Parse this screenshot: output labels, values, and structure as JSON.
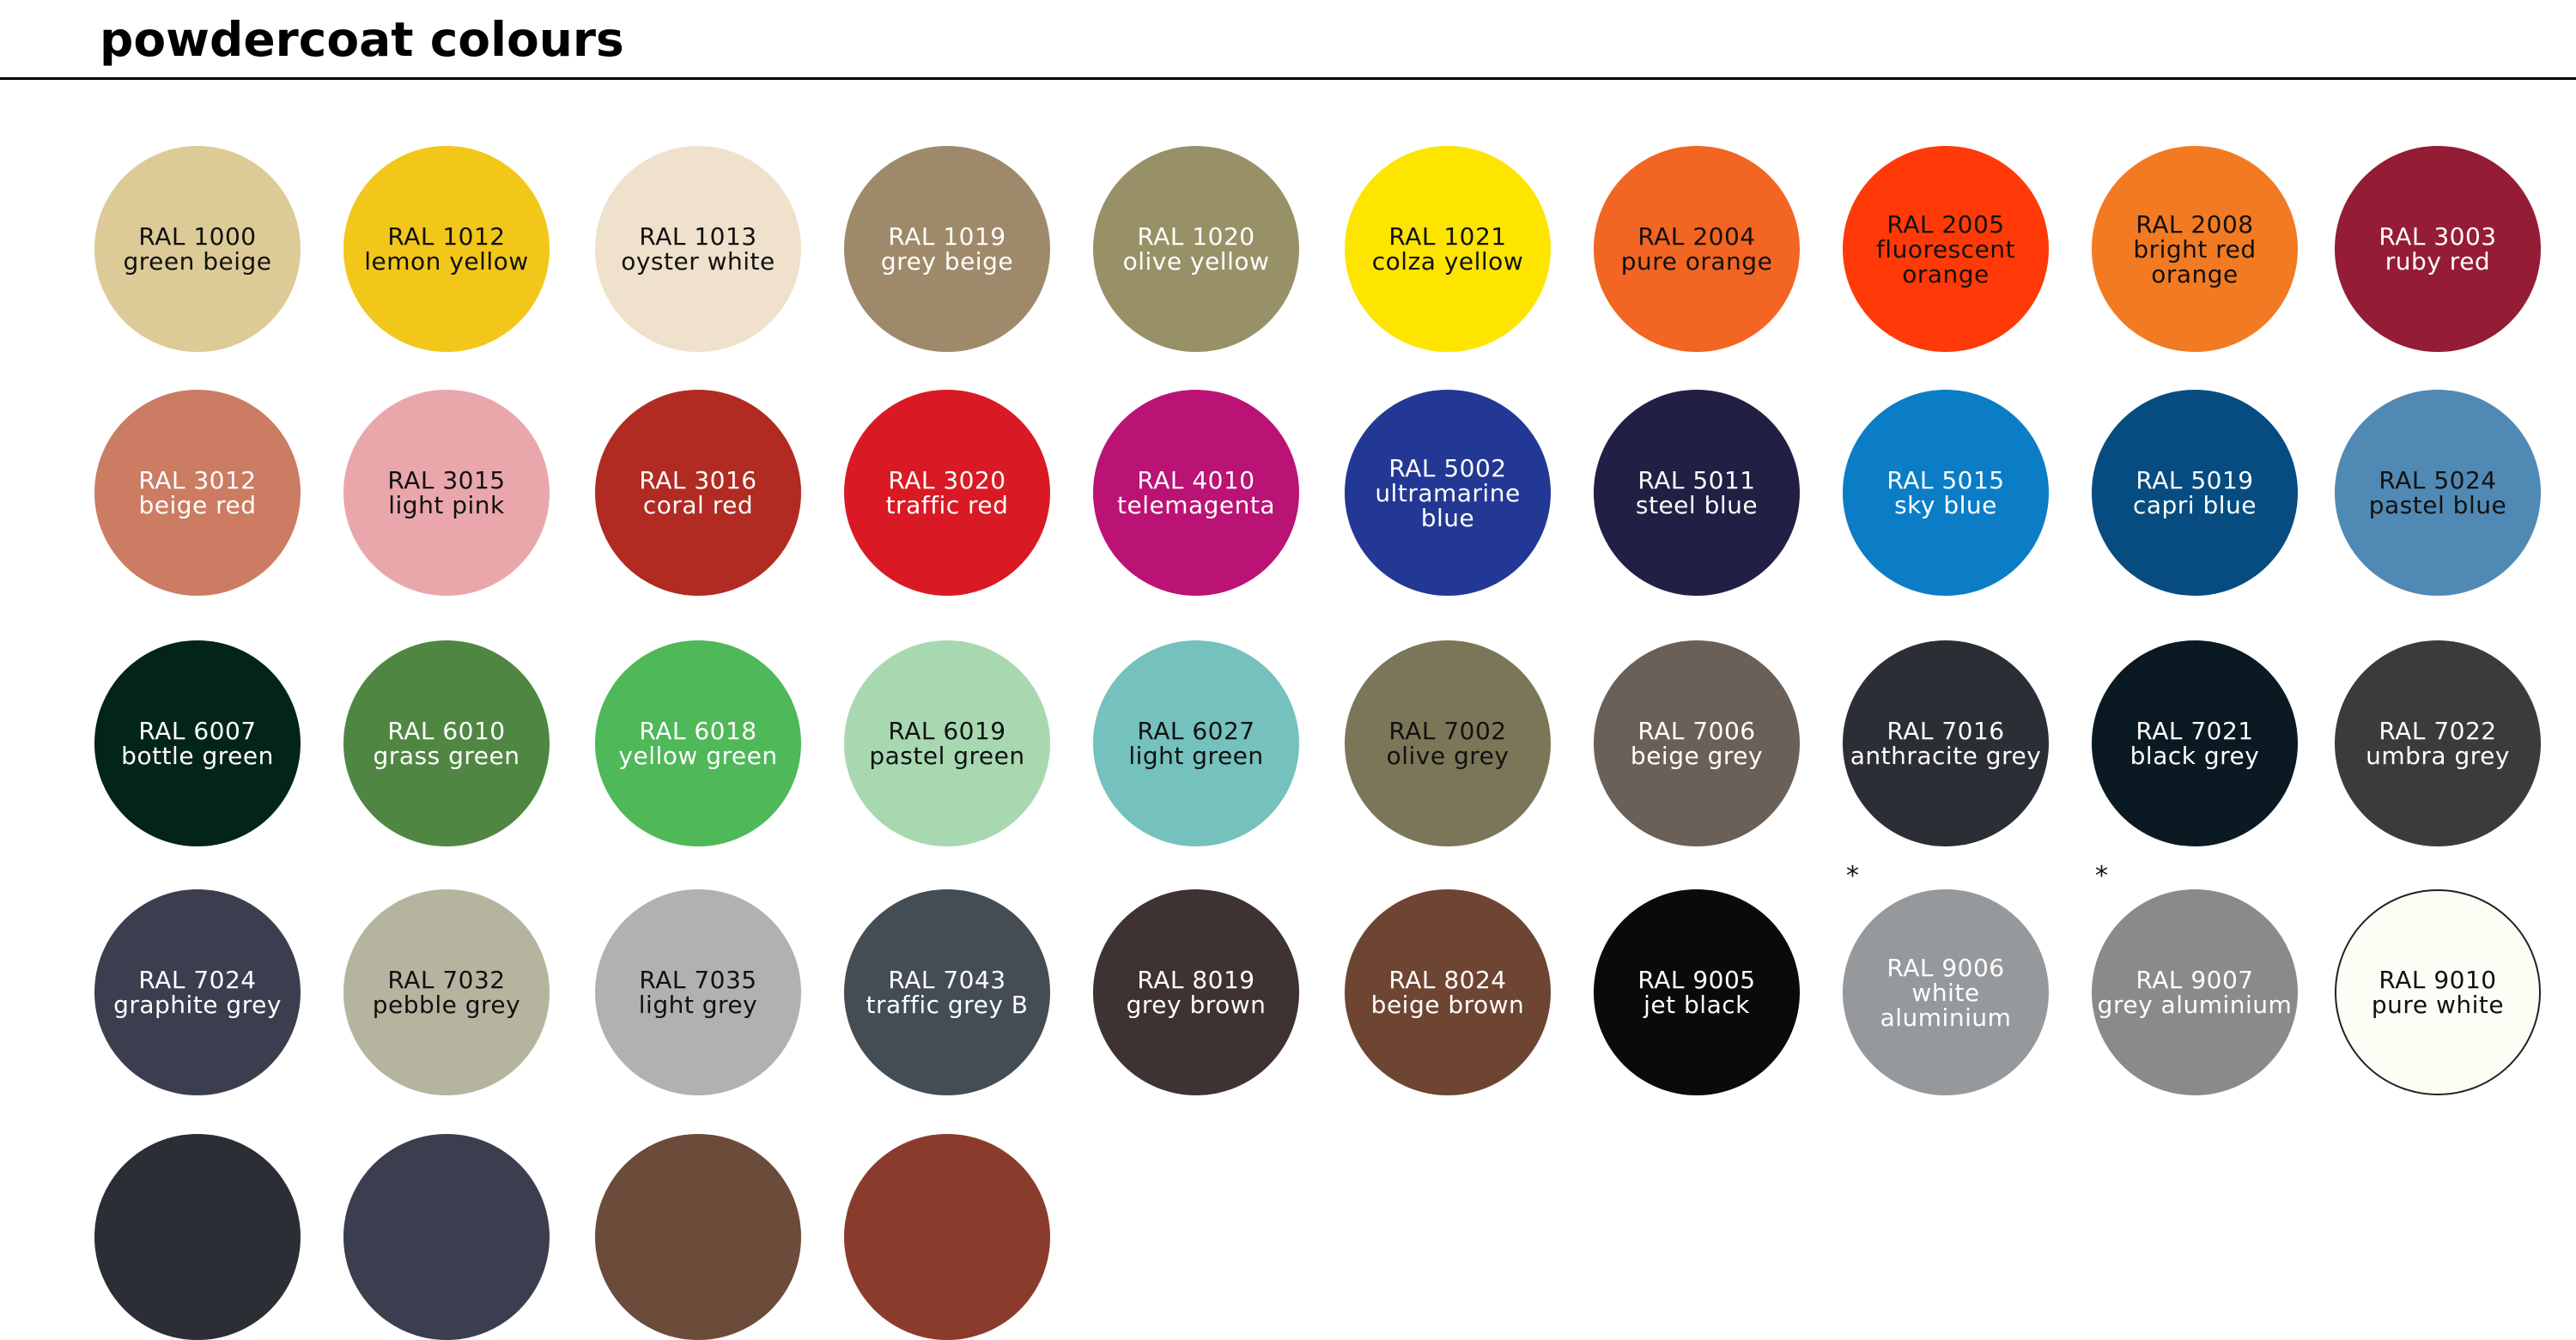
{
  "header": {
    "title": "powdercoat colours"
  },
  "swatches": [
    {
      "code": "RAL 1000",
      "name": "green beige",
      "color": "#dccb97",
      "text": "#111111"
    },
    {
      "code": "RAL 1012",
      "name": "lemon yellow",
      "color": "#f2c71a",
      "text": "#111111"
    },
    {
      "code": "RAL 1013",
      "name": "oyster white",
      "color": "#efe1cb",
      "text": "#111111"
    },
    {
      "code": "RAL 1019",
      "name": "grey beige",
      "color": "#9e8a6b",
      "text": "#ffffff"
    },
    {
      "code": "RAL 1020",
      "name": "olive yellow",
      "color": "#989168",
      "text": "#ffffff"
    },
    {
      "code": "RAL 1021",
      "name": "colza yellow",
      "color": "#fde500",
      "text": "#111111"
    },
    {
      "code": "RAL 2004",
      "name": "pure orange",
      "color": "#f26522",
      "text": "#111111"
    },
    {
      "code": "RAL 2005",
      "name": "fluorescent orange",
      "color": "#ff3a08",
      "text": "#111111"
    },
    {
      "code": "RAL 2008",
      "name": "bright red orange",
      "color": "#f27a22",
      "text": "#111111"
    },
    {
      "code": "RAL 3003",
      "name": "ruby red",
      "color": "#951c35",
      "text": "#ffffff"
    },
    {
      "code": "RAL 3012",
      "name": "beige red",
      "color": "#cb7c62",
      "text": "#ffffff"
    },
    {
      "code": "RAL 3015",
      "name": "light pink",
      "color": "#e9a7ac",
      "text": "#111111"
    },
    {
      "code": "RAL 3016",
      "name": "coral red",
      "color": "#b12b22",
      "text": "#ffffff"
    },
    {
      "code": "RAL 3020",
      "name": "traffic red",
      "color": "#d91a24",
      "text": "#ffffff"
    },
    {
      "code": "RAL 4010",
      "name": "telemagenta",
      "color": "#bb1275",
      "text": "#ffffff"
    },
    {
      "code": "RAL 5002",
      "name": "ultramarine blue",
      "color": "#233894",
      "text": "#ffffff"
    },
    {
      "code": "RAL 5011",
      "name": "steel blue",
      "color": "#221f45",
      "text": "#ffffff"
    },
    {
      "code": "RAL 5015",
      "name": "sky blue",
      "color": "#0b7dc6",
      "text": "#ffffff"
    },
    {
      "code": "RAL 5019",
      "name": "capri blue",
      "color": "#064c80",
      "text": "#ffffff"
    },
    {
      "code": "RAL 5024",
      "name": "pastel blue",
      "color": "#5089b4",
      "text": "#111111"
    },
    {
      "code": "RAL 6007",
      "name": "bottle green",
      "color": "#03241a",
      "text": "#ffffff"
    },
    {
      "code": "RAL 6010",
      "name": "grass green",
      "color": "#4f8742",
      "text": "#ffffff"
    },
    {
      "code": "RAL 6018",
      "name": "yellow green",
      "color": "#4fb858",
      "text": "#ffffff"
    },
    {
      "code": "RAL 6019",
      "name": "pastel green",
      "color": "#a8d8b0",
      "text": "#111111"
    },
    {
      "code": "RAL 6027",
      "name": "light green",
      "color": "#74c1bd",
      "text": "#111111"
    },
    {
      "code": "RAL 7002",
      "name": "olive grey",
      "color": "#7c7658",
      "text": "#111111"
    },
    {
      "code": "RAL 7006",
      "name": "beige grey",
      "color": "#6b6057",
      "text": "#ffffff"
    },
    {
      "code": "RAL 7016",
      "name": "anthracite grey",
      "color": "#2c2e35",
      "text": "#ffffff"
    },
    {
      "code": "RAL 7021",
      "name": "black grey",
      "color": "#0b1a22",
      "text": "#ffffff"
    },
    {
      "code": "RAL 7022",
      "name": "umbra grey",
      "color": "#3b3b3b",
      "text": "#ffffff"
    },
    {
      "code": "RAL 7024",
      "name": "graphite grey",
      "color": "#3b3e4f",
      "text": "#ffffff"
    },
    {
      "code": "RAL 7032",
      "name": "pebble grey",
      "color": "#b5b59f",
      "text": "#111111"
    },
    {
      "code": "RAL 7035",
      "name": "light grey",
      "color": "#b1b0b2",
      "text": "#111111"
    },
    {
      "code": "RAL 7043",
      "name": "traffic grey B",
      "color": "#444c54",
      "text": "#ffffff"
    },
    {
      "code": "RAL 8019",
      "name": "grey brown",
      "color": "#3e3232",
      "text": "#ffffff"
    },
    {
      "code": "RAL 8024",
      "name": "beige brown",
      "color": "#6e4532",
      "text": "#ffffff"
    },
    {
      "code": "RAL 9005",
      "name": "jet black",
      "color": "#0a0a0a",
      "text": "#ffffff"
    },
    {
      "code": "RAL 9006",
      "name": "white aluminium",
      "color": "#96999c",
      "text": "#ffffff",
      "asterisk": "*"
    },
    {
      "code": "RAL 9007",
      "name": "grey aluminium",
      "color": "#8a8a8c",
      "text": "#ffffff",
      "asterisk": "*"
    },
    {
      "code": "RAL 9010",
      "name": "pure white",
      "color": "#fcfdf5",
      "text": "#111111",
      "border": true
    }
  ],
  "partial_row_colors": [
    "#2c2e35",
    "#3b3e4f",
    "#6b4b3a",
    "#8b3b2c"
  ]
}
